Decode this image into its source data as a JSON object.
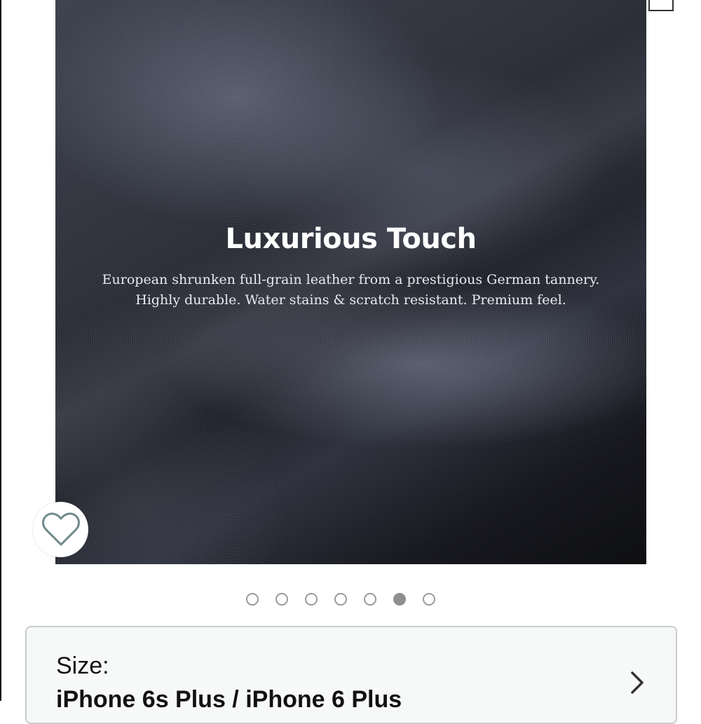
{
  "product_image": {
    "title": "Luxurious Touch",
    "line1": "European shrunken full-grain leather from a prestigious German tannery.",
    "line2": "Highly durable. Water stains & scratch resistant. Premium feel."
  },
  "wishlist": {
    "icon": "heart-outline-icon"
  },
  "carousel": {
    "total": 7,
    "active_index": 5
  },
  "size": {
    "label": "Size:",
    "value": "iPhone 6s Plus / iPhone 6 Plus",
    "icon": "chevron-right-icon"
  },
  "colors": {
    "dot_active": "#8f8f8f",
    "dot_border": "#9a9a9a",
    "card_border": "#c9cccc"
  }
}
